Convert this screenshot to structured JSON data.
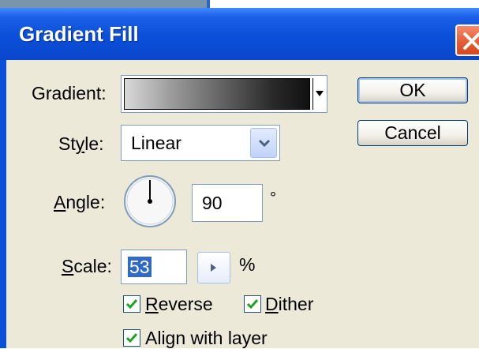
{
  "window": {
    "title": "Gradient Fill"
  },
  "gradient": {
    "label_prefix": "",
    "label": "Gradient:"
  },
  "style": {
    "label_pre": "St",
    "label_mnemonic": "y",
    "label_post": "le:",
    "value": "Linear"
  },
  "angle": {
    "label_mnemonic": "A",
    "label_post": "ngle:",
    "value": "90",
    "unit": "°"
  },
  "scale": {
    "label_mnemonic": "S",
    "label_post": "cale:",
    "value": "53",
    "unit": "%"
  },
  "options": {
    "reverse": {
      "mnemonic": "R",
      "rest": "everse",
      "checked": true
    },
    "dither": {
      "mnemonic": "D",
      "rest": "ither",
      "checked": true
    },
    "align": {
      "mnemonic": "",
      "label": "Align with layer",
      "checked": true
    }
  },
  "buttons": {
    "ok": "OK",
    "cancel": "Cancel"
  },
  "colors": {
    "titlebar": "#0a4fd8",
    "dialog_bg": "#ece9d8",
    "selection": "#316ac5",
    "close": "#e25b33"
  }
}
